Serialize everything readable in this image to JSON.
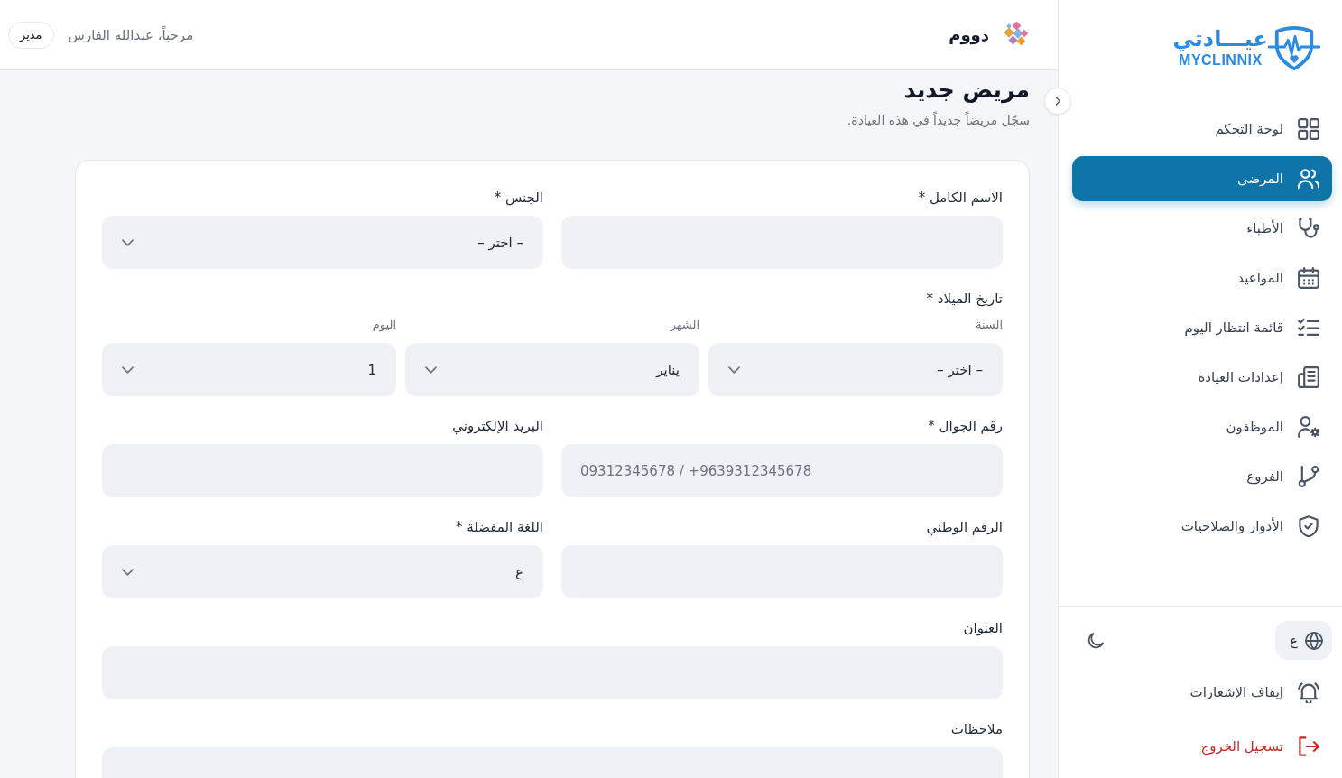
{
  "sidebar": {
    "logo": {
      "arabic": "عيـــادتي",
      "latin": "MYCLINNIX"
    },
    "nav": [
      {
        "label": "لوحة التحكم",
        "selected": false
      },
      {
        "label": "المرضى",
        "selected": true
      },
      {
        "label": "الأطباء",
        "selected": false
      },
      {
        "label": "المواعيد",
        "selected": false
      },
      {
        "label": "قائمة انتظار اليوم",
        "selected": false
      },
      {
        "label": "إعدادات العيادة",
        "selected": false
      },
      {
        "label": "الموظفون",
        "selected": false
      },
      {
        "label": "الفروع",
        "selected": false
      },
      {
        "label": "الأدوار والصلاحيات",
        "selected": false
      }
    ],
    "language_button": "ع",
    "footer_items": [
      {
        "kind": "normal",
        "label": "إيقاف الإشعارات"
      },
      {
        "kind": "danger",
        "label": "تسجيل الخروج"
      }
    ]
  },
  "header": {
    "clinic_name": "دووم",
    "greeting": "مرحباً، عبدالله الفارس",
    "role_badge": "مدير"
  },
  "page": {
    "title": "مريض جديد",
    "subtitle": "سجّل مريضاً جديداً في هذه العيادة."
  },
  "form": {
    "rows": [
      {
        "fields": [
          {
            "kind": "text",
            "label": "الاسم الكامل *"
          },
          {
            "kind": "select",
            "label": "الجنس *",
            "value": "– اختر –"
          }
        ]
      },
      {
        "fields": [
          {
            "kind": "date",
            "label": "تاريخ الميلاد *",
            "parts": [
              {
                "label": "السنة",
                "value": "– اختر –"
              },
              {
                "label": "الشهر",
                "value": "يناير"
              },
              {
                "label": "اليوم",
                "value": "1"
              }
            ]
          }
        ]
      },
      {
        "fields": [
          {
            "kind": "tel",
            "label": "رقم الجوال *",
            "placeholder": "09312345678 / +9639312345678"
          },
          {
            "kind": "text",
            "label": "البريد الإلكتروني"
          }
        ]
      },
      {
        "fields": [
          {
            "kind": "text",
            "label": "الرقم الوطني"
          },
          {
            "kind": "select",
            "label": "اللغة المفضلة *",
            "value": "ع"
          }
        ]
      },
      {
        "fields": [
          {
            "kind": "text",
            "label": "العنوان"
          }
        ]
      },
      {
        "fields": [
          {
            "kind": "textarea",
            "label": "ملاحظات"
          }
        ]
      }
    ]
  }
}
